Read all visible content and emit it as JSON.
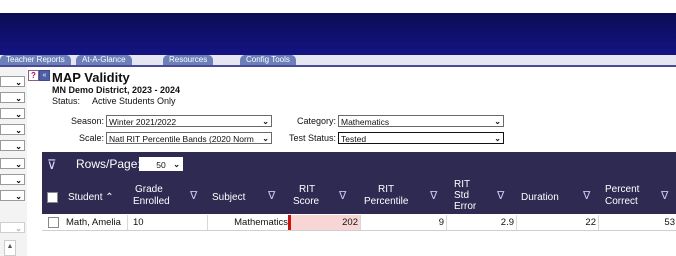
{
  "tabs": [
    "Teacher Reports",
    "At-A-Glance",
    "Resources",
    "Config Tools"
  ],
  "report": {
    "title": "MAP Validity",
    "subtitle": "MN Demo District, 2023 - 2024",
    "status_label": "Status:",
    "status_value": "Active Students Only"
  },
  "filters": {
    "season_label": "Season:",
    "season_value": "Winter 2021/2022",
    "scale_label": "Scale:",
    "scale_value": "Natl RIT Percentile Bands (2020 Norm",
    "category_label": "Category:",
    "category_value": "Mathematics",
    "test_status_label": "Test Status:",
    "test_status_value": "Tested"
  },
  "grid": {
    "rows_per_page_label": "Rows/Page:",
    "rows_per_page_value": "50",
    "columns": {
      "student": "Student",
      "grade_1": "Grade",
      "grade_2": "Enrolled",
      "subject": "Subject",
      "rit_1": "RIT",
      "rit_2": "Score",
      "pct_1": "RIT",
      "pct_2": "Percentile",
      "err_1": "RIT",
      "err_2": "Std",
      "err_3": "Error",
      "duration": "Duration",
      "correct_1": "Percent",
      "correct_2": "Correct"
    },
    "rows": [
      {
        "student": "Math, Amelia",
        "grade": "10",
        "subject": "Mathematics",
        "rit_score": "202",
        "rit_percentile": "9",
        "rit_std_error": "2.9",
        "duration": "22",
        "percent_correct": "53"
      }
    ]
  },
  "colors": {
    "banner": "#101070",
    "grid_header": "#2e2a52",
    "tab": "#6c7fb8",
    "rit_highlight": "#f9d6d6",
    "rit_flag": "#cc1111"
  }
}
